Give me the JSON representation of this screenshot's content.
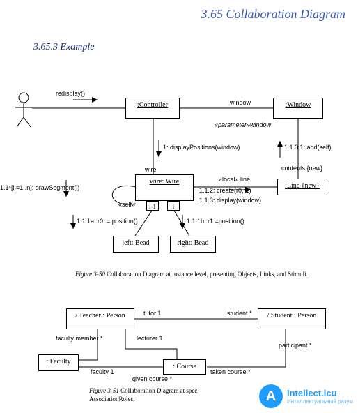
{
  "header": {
    "section_title": "3.65  Collaboration Diagram",
    "subsection": "3.65.3  Example"
  },
  "fig50": {
    "boxes": {
      "controller": ":Controller",
      "window": ":Window",
      "wire": "wire: Wire",
      "left_bead": "left: Bead",
      "right_bead": "right: Bead",
      "line": ":Line {new}"
    },
    "quals": {
      "left": "i-1",
      "right": "i"
    },
    "labels": {
      "redisplay": "redisplay()",
      "window_link": "window",
      "param_window": "«parameter»window",
      "msg1": "1: displayPositions(window)",
      "wire_assoc": "wire",
      "local_line": "«local» line",
      "msg112": "1.1.2: create(r0,r1)",
      "msg113": "1.1.3: display(window)",
      "contents_new": "contents {new}",
      "msg1131": "1.1.3.1: add(self)",
      "draw_seg": "1.1*[i:=1..n]: drawSegment(i)",
      "self": "«self»",
      "msg11a": "1.1.1a: r0 := position()",
      "msg11b": "1.1.1b: r1:=position()"
    },
    "caption_prefix": "Figure 3-50",
    "caption_rest": "  Collaboration Diagram at instance level, presenting Objects, Links, and Stimuli."
  },
  "fig51": {
    "boxes": {
      "teacher": "/ Teacher : Person",
      "student": "/ Student : Person",
      "faculty": ": Faculty",
      "course": ": Course"
    },
    "labels": {
      "tutor": "tutor 1",
      "student_mult": "student *",
      "faculty_member": "faculty member *",
      "lecturer": "lecturer 1",
      "participant": "participant *",
      "faculty1": "faculty 1",
      "given_course": "given course *",
      "taken_course": "taken course *"
    },
    "caption_prefix": "Figure 3-51",
    "caption_rest_a": "  Collaboration Diagram at spec",
    "caption_rest_b": "AssociationRoles."
  },
  "watermark": {
    "letter": "A",
    "title": "Intellect.icu",
    "subtitle": "Интеллектуальный разум"
  }
}
